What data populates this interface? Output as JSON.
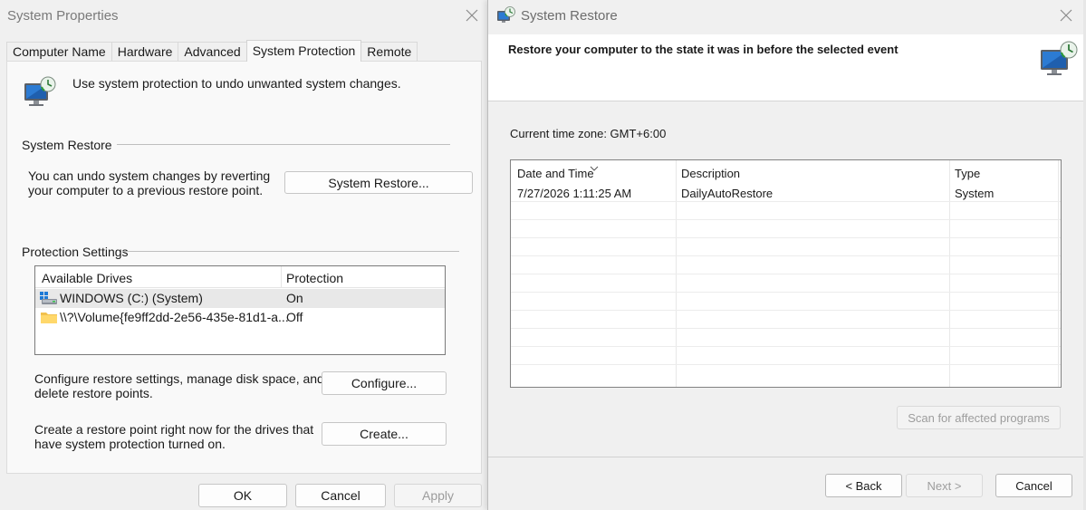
{
  "sysprops": {
    "title": "System Properties",
    "tabs": [
      {
        "label": "Computer Name"
      },
      {
        "label": "Hardware"
      },
      {
        "label": "Advanced"
      },
      {
        "label": "System Protection"
      },
      {
        "label": "Remote"
      }
    ],
    "intro": "Use system protection to undo unwanted system changes.",
    "restore_group": "System Restore",
    "restore_desc_1": "You can undo system changes by reverting",
    "restore_desc_2": "your computer to a previous restore point.",
    "restore_button": "System Restore...",
    "protection_group": "Protection Settings",
    "drives_header": {
      "drive": "Available Drives",
      "protection": "Protection"
    },
    "drives": [
      {
        "name": "WINDOWS (C:) (System)",
        "protection": "On",
        "icon": "system-drive-icon"
      },
      {
        "name": "\\\\?\\Volume{fe9ff2dd-2e56-435e-81d1-a...",
        "protection": "Off",
        "icon": "folder-icon"
      }
    ],
    "configure_desc_1": "Configure restore settings, manage disk space, and",
    "configure_desc_2": "delete restore points.",
    "configure_button": "Configure...",
    "create_desc_1": "Create a restore point right now for the drives that",
    "create_desc_2": "have system protection turned on.",
    "create_button": "Create...",
    "ok": "OK",
    "cancel": "Cancel",
    "apply": "Apply"
  },
  "restore": {
    "title": "System Restore",
    "heading": "Restore your computer to the state it was in before the selected event",
    "timezone": "Current time zone: GMT+6:00",
    "columns": {
      "date": "Date and Time",
      "description": "Description",
      "type": "Type"
    },
    "points": [
      {
        "date": "7/27/2026 1:11:25 AM",
        "description": "DailyAutoRestore",
        "type": "System"
      }
    ],
    "scan_button": "Scan for affected programs",
    "back": "< Back",
    "next": "Next >",
    "cancel": "Cancel"
  },
  "colors": {
    "accent": "#2c7bd3",
    "window_bg": "#f0f0f0",
    "panel_bg": "#f9f9f9"
  }
}
